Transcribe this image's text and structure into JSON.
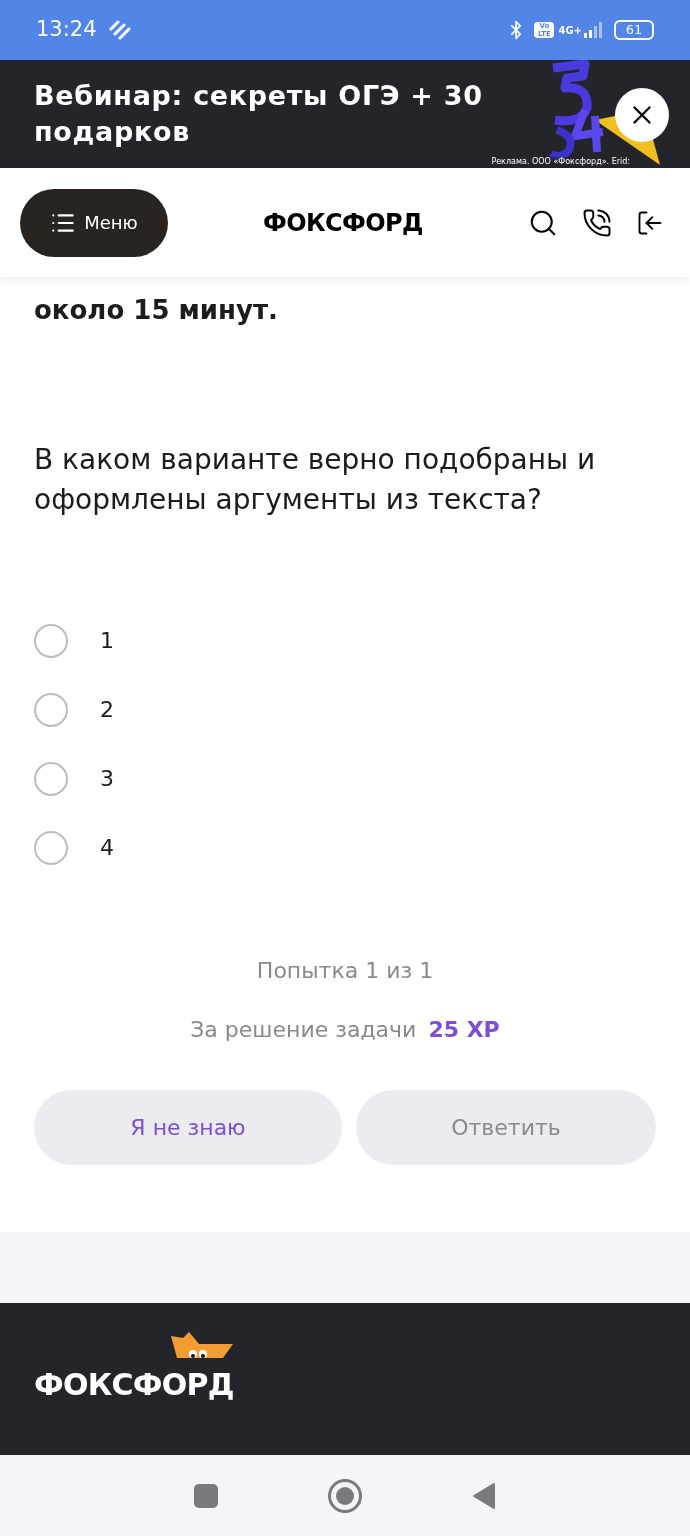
{
  "status_bar": {
    "time": "13:24",
    "battery": "61",
    "network": "4G+",
    "volte": "Vo LTE"
  },
  "ad_banner": {
    "title": "Вебинар: секреты ОГЭ + 30 подарков",
    "disclaimer": "Реклама. ООО «Фоксфорд». Erid:"
  },
  "header": {
    "menu_label": "Меню",
    "logo": "ФОКСФОРД"
  },
  "task": {
    "intro_tail": "около 15 минут.",
    "question": "В каком варианте верно подобраны и оформлены аргументы из текста?",
    "options": [
      {
        "label": "1",
        "selected": false
      },
      {
        "label": "2",
        "selected": false
      },
      {
        "label": "3",
        "selected": false
      },
      {
        "label": "4",
        "selected": false
      }
    ],
    "attempt": "Попытка 1 из 1",
    "reward_label": "За решение задачи",
    "reward_value": "25 XP",
    "buttons": [
      {
        "label": "Я не знаю",
        "disabled": false
      },
      {
        "label": "Ответить",
        "disabled": true
      }
    ]
  },
  "footer": {
    "logo": "ФОКСФОРД"
  }
}
